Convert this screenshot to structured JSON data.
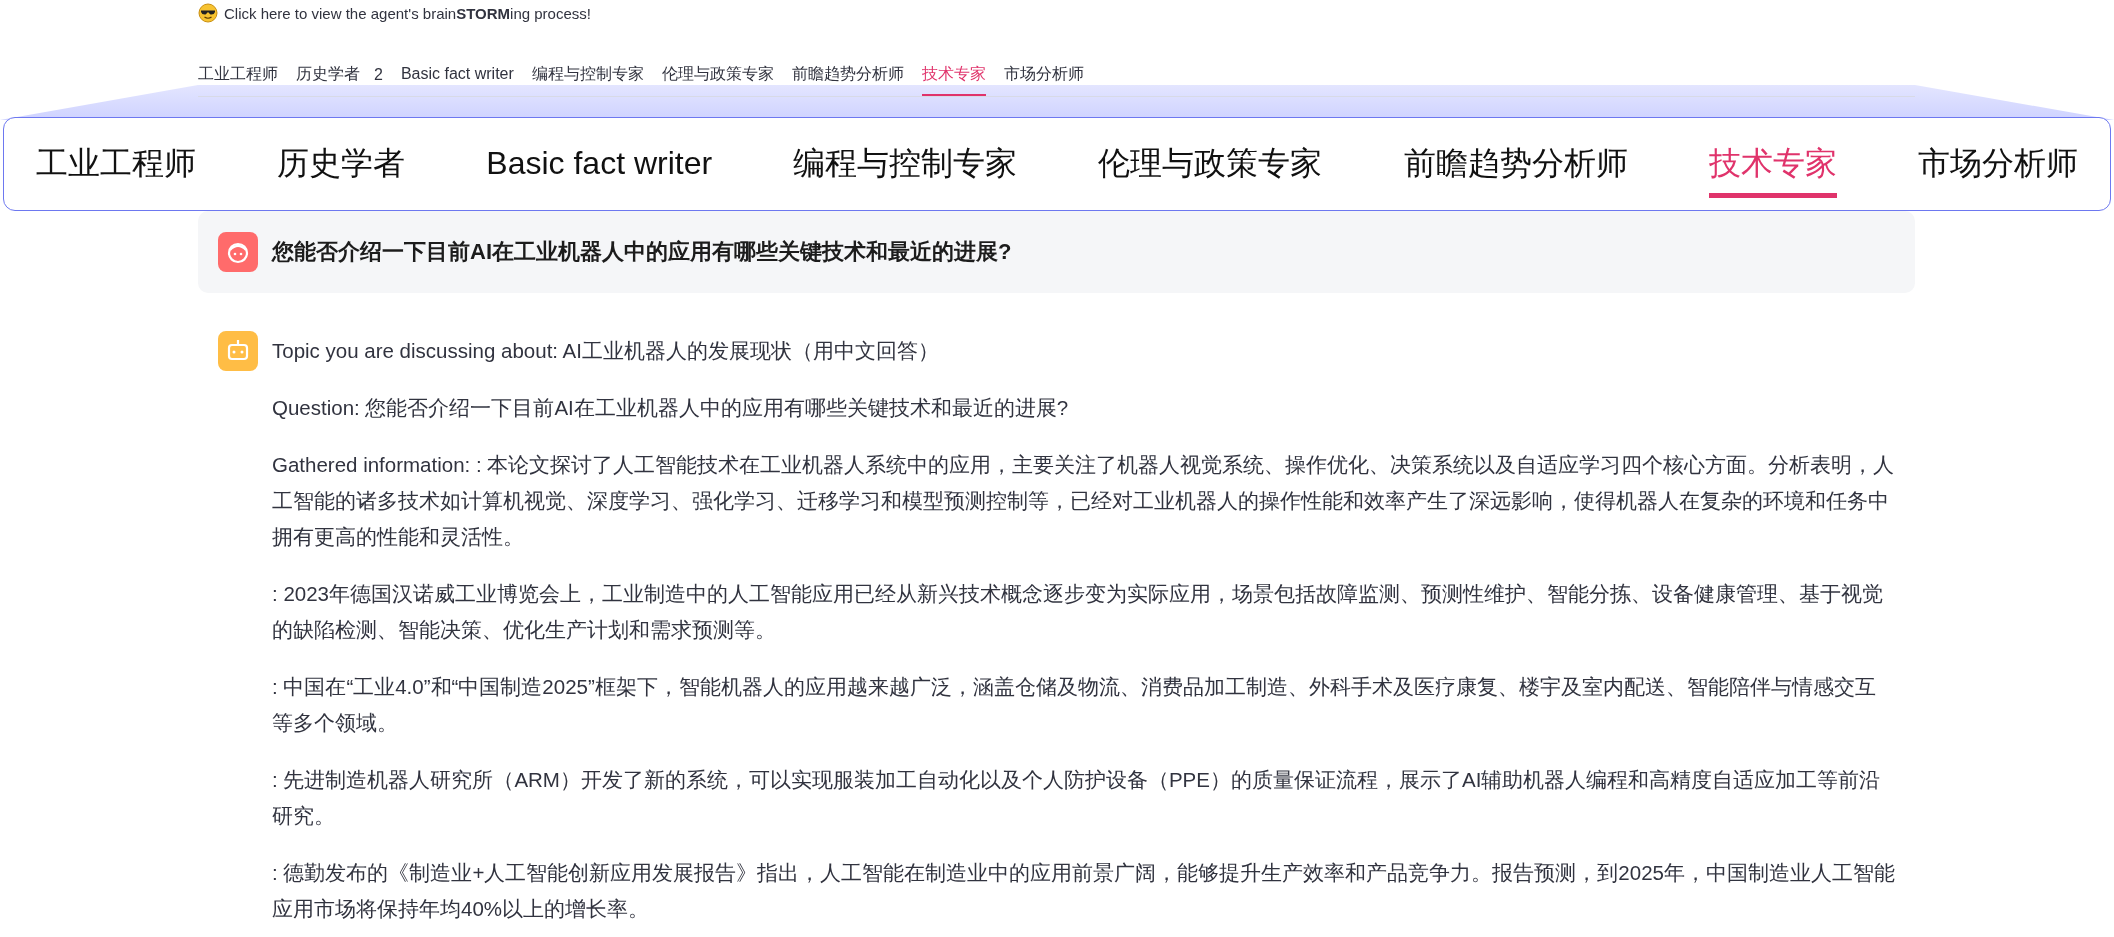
{
  "header": {
    "text": "Click here to view the agent's brain**STORM**ing process!"
  },
  "tabs": [
    {
      "label": "工业工程师",
      "selected": false
    },
    {
      "label": "历史学者",
      "selected": false,
      "count": "2"
    },
    {
      "label": "Basic fact writer",
      "selected": false
    },
    {
      "label": "编程与控制专家",
      "selected": false
    },
    {
      "label": "伦理与政策专家",
      "selected": false
    },
    {
      "label": "前瞻趋势分析师",
      "selected": false
    },
    {
      "label": "技术专家",
      "selected": true
    },
    {
      "label": "市场分析师",
      "selected": false
    }
  ],
  "zoomed_tabs": [
    {
      "label": "工业工程师",
      "selected": false
    },
    {
      "label": "历史学者",
      "selected": false
    },
    {
      "label": "Basic fact writer",
      "selected": false
    },
    {
      "label": "编程与控制专家",
      "selected": false
    },
    {
      "label": "伦理与政策专家",
      "selected": false
    },
    {
      "label": "前瞻趋势分析师",
      "selected": false
    },
    {
      "label": "技术专家",
      "selected": true
    },
    {
      "label": "市场分析师",
      "selected": false
    }
  ],
  "question": {
    "text": "您能否介绍一下目前AI在工业机器人中的应用有哪些关键技术和最近的进展?"
  },
  "answer": {
    "paragraphs": [
      "Topic you are discussing about: AI工业机器人的发展现状（用中文回答）",
      "Question: 您能否介绍一下目前AI在工业机器人中的应用有哪些关键技术和最近的进展?",
      "Gathered information: : 本论文探讨了人工智能技术在工业机器人系统中的应用，主要关注了机器人视觉系统、操作优化、决策系统以及自适应学习四个核心方面。分析表明，人工智能的诸多技术如计算机视觉、深度学习、强化学习、迁移学习和模型预测控制等，已经对工业机器人的操作性能和效率产生了深远影响，使得机器人在复杂的环境和任务中拥有更高的性能和灵活性。",
      ": 2023年德国汉诺威工业博览会上，工业制造中的人工智能应用已经从新兴技术概念逐步变为实际应用，场景包括故障监测、预测性维护、智能分拣、设备健康管理、基于视觉的缺陷检测、智能决策、优化生产计划和需求预测等。",
      ": 中国在“工业4.0”和“中国制造2025”框架下，智能机器人的应用越来越广泛，涵盖仓储及物流、消费品加工制造、外科手术及医疗康复、楼宇及室内配送、智能陪伴与情感交互等多个领域。",
      ": 先进制造机器人研究所（ARM）开发了新的系统，可以实现服装加工自动化以及个人防护设备（PPE）的质量保证流程，展示了AI辅助机器人编程和高精度自适应加工等前沿研究。",
      ": 德勤发布的《制造业+人工智能创新应用发展报告》指出，人工智能在制造业中的应用前景广阔，能够提升生产效率和产品竞争力。报告预测，到2025年，中国制造业人工智能应用市场将保持年均40%以上的增长率。"
    ]
  }
}
